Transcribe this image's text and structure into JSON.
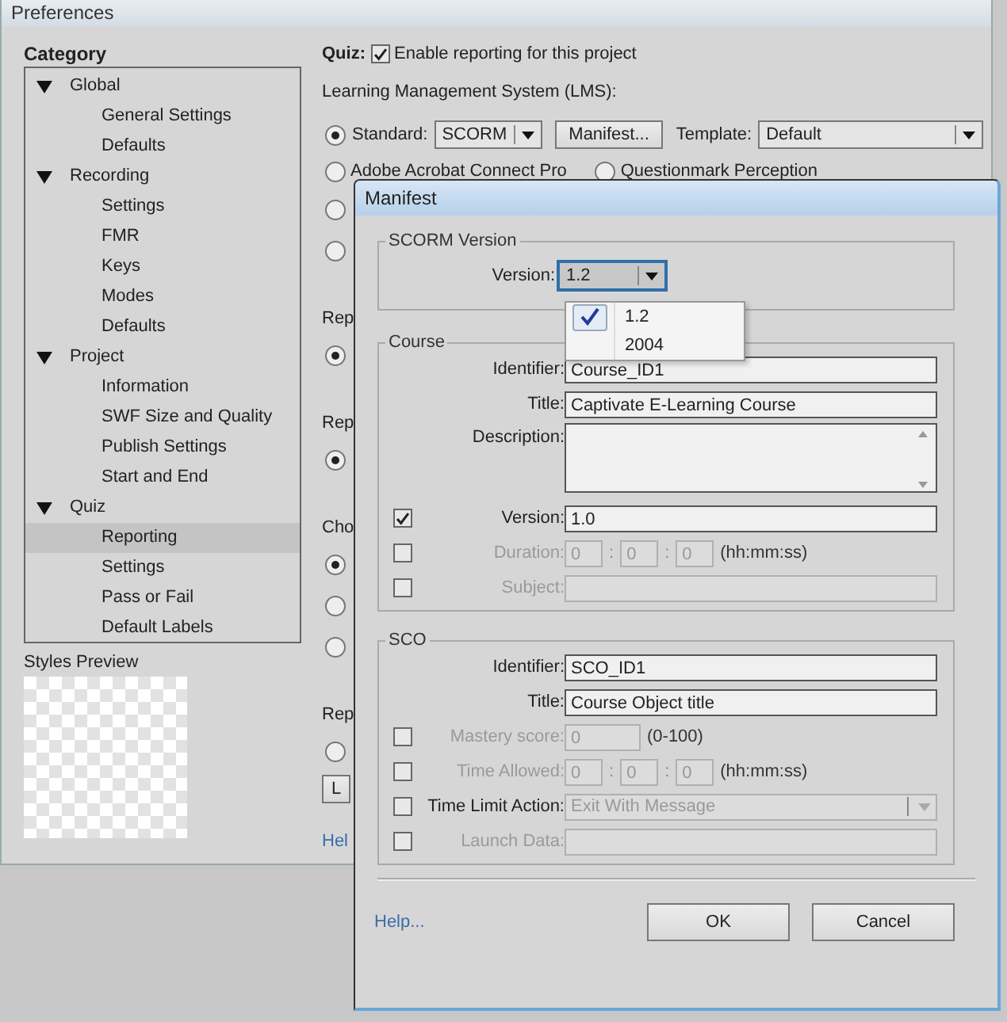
{
  "window": {
    "title": "Preferences"
  },
  "category": {
    "label": "Category",
    "tree": [
      {
        "label": "Global",
        "expanded": true,
        "selected": false,
        "children": [
          {
            "label": "General Settings",
            "selected": false
          },
          {
            "label": "Defaults",
            "selected": false
          }
        ]
      },
      {
        "label": "Recording",
        "expanded": true,
        "selected": false,
        "children": [
          {
            "label": "Settings",
            "selected": false
          },
          {
            "label": "FMR",
            "selected": false
          },
          {
            "label": "Keys",
            "selected": false
          },
          {
            "label": "Modes",
            "selected": false
          },
          {
            "label": "Defaults",
            "selected": false
          }
        ]
      },
      {
        "label": "Project",
        "expanded": true,
        "selected": false,
        "children": [
          {
            "label": "Information",
            "selected": false
          },
          {
            "label": "SWF Size and Quality",
            "selected": false
          },
          {
            "label": "Publish Settings",
            "selected": false
          },
          {
            "label": "Start and End",
            "selected": false
          }
        ]
      },
      {
        "label": "Quiz",
        "expanded": true,
        "selected": false,
        "children": [
          {
            "label": "Reporting",
            "selected": true
          },
          {
            "label": "Settings",
            "selected": false
          },
          {
            "label": "Pass or Fail",
            "selected": false
          },
          {
            "label": "Default Labels",
            "selected": false
          }
        ]
      }
    ]
  },
  "styles_preview": {
    "label": "Styles Preview"
  },
  "quiz": {
    "label": "Quiz:",
    "enable_reporting": {
      "label": "Enable reporting for this project",
      "checked": true
    },
    "lms_label": "Learning Management System (LMS):",
    "standard": {
      "label": "Standard:",
      "selected": true,
      "value": "SCORM"
    },
    "manifest_button": "Manifest...",
    "template": {
      "label": "Template:",
      "value": "Default"
    },
    "lms_options": [
      {
        "label": "Adobe Acrobat Connect Pro",
        "selected": false
      },
      {
        "label": "Questionmark Perception",
        "selected": false
      }
    ],
    "more_lms": [
      {
        "selected": false
      },
      {
        "selected": false
      }
    ],
    "sections": [
      {
        "label": "Rep",
        "radios": [
          {
            "selected": true
          }
        ]
      },
      {
        "label": "Rep",
        "radios": [
          {
            "selected": true
          }
        ]
      },
      {
        "label": "Cho",
        "radios": [
          {
            "selected": true
          },
          {
            "selected": false
          },
          {
            "selected": false
          }
        ]
      },
      {
        "label": "Rep",
        "radios": [
          {
            "selected": false
          }
        ],
        "button": "L"
      }
    ],
    "help_link": "Hel"
  },
  "manifest": {
    "title": "Manifest",
    "scorm_version": {
      "legend": "SCORM Version",
      "label": "Version:",
      "value": "1.2",
      "options": [
        {
          "label": "1.2",
          "selected": true
        },
        {
          "label": "2004",
          "selected": false
        }
      ]
    },
    "course": {
      "legend": "Course",
      "rows": [
        {
          "kind": "text",
          "label": "Identifier:",
          "value": "Course_ID1",
          "disabled": false
        },
        {
          "kind": "text",
          "label": "Title:",
          "value": "Captivate E-Learning Course",
          "disabled": false
        },
        {
          "kind": "textarea",
          "label": "Description:",
          "disabled": false
        },
        {
          "kind": "text",
          "label": "Version:",
          "value": "1.0",
          "checked": true,
          "disabled": false
        },
        {
          "kind": "time",
          "label": "Duration:",
          "values": [
            "0",
            "0",
            "0"
          ],
          "separators": [
            ":",
            ":"
          ],
          "hint": "(hh:mm:ss)",
          "checked": false,
          "disabled": true
        },
        {
          "kind": "text",
          "label": "Subject:",
          "checked": false,
          "disabled": true
        }
      ]
    },
    "sco": {
      "legend": "SCO",
      "rows": [
        {
          "kind": "text",
          "label": "Identifier:",
          "value": "SCO_ID1",
          "disabled": false
        },
        {
          "kind": "text",
          "label": "Title:",
          "value": "Course Object title",
          "disabled": false
        },
        {
          "kind": "score",
          "label": "Mastery score:",
          "value": "0",
          "hint": "(0-100)",
          "checked": false,
          "disabled": true
        },
        {
          "kind": "time",
          "label": "Time Allowed:",
          "values": [
            "0",
            "0",
            "0"
          ],
          "separators": [
            ":",
            ":"
          ],
          "hint": "(hh:mm:ss)",
          "checked": false,
          "disabled": true
        },
        {
          "kind": "select",
          "label": "Time Limit Action:",
          "value": "Exit With Message",
          "checked": false,
          "disabled": false,
          "field_disabled": true
        },
        {
          "kind": "text",
          "label": "Launch Data:",
          "checked": false,
          "disabled": true
        }
      ]
    },
    "help_link": "Help...",
    "buttons": [
      "OK",
      "Cancel"
    ]
  }
}
